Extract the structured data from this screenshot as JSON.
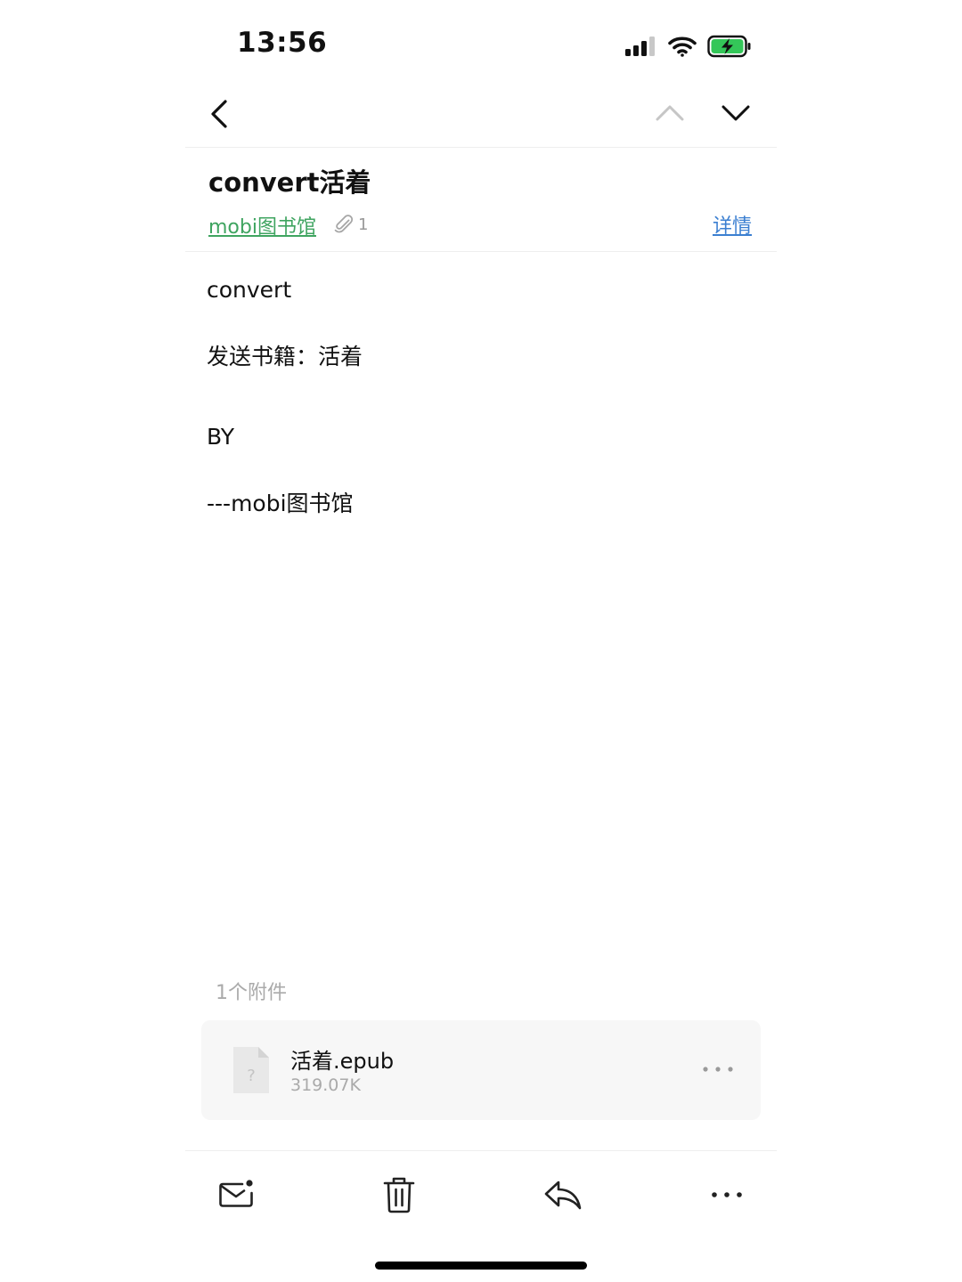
{
  "status_bar": {
    "time": "13:56",
    "signal_icon": "cellular-signal-icon",
    "wifi_icon": "wifi-icon",
    "battery_icon": "battery-charging-icon",
    "battery_color": "#34c759"
  },
  "nav": {
    "back_icon": "chevron-left-icon",
    "prev_icon": "chevron-up-icon",
    "next_icon": "chevron-down-icon"
  },
  "email": {
    "subject": "convert活着",
    "sender": "mobi图书馆",
    "attachment_count": "1",
    "details_label": "详情",
    "body": {
      "line1": "convert",
      "line2": "发送书籍：活着",
      "line3": "BY",
      "line4": "---mobi图书馆"
    }
  },
  "attachments": {
    "header": "1个附件",
    "items": [
      {
        "name": "活着.epub",
        "size": "319.07K",
        "icon": "unknown-file-icon"
      }
    ]
  },
  "toolbar": {
    "mark_unread_icon": "mail-unread-icon",
    "delete_icon": "trash-icon",
    "reply_icon": "reply-icon",
    "more_icon": "more-icon"
  },
  "colors": {
    "sender_link": "#3fa460",
    "details_link": "#3b7fd1",
    "muted_text": "#aaaaaa",
    "card_bg": "#f7f7f7"
  }
}
